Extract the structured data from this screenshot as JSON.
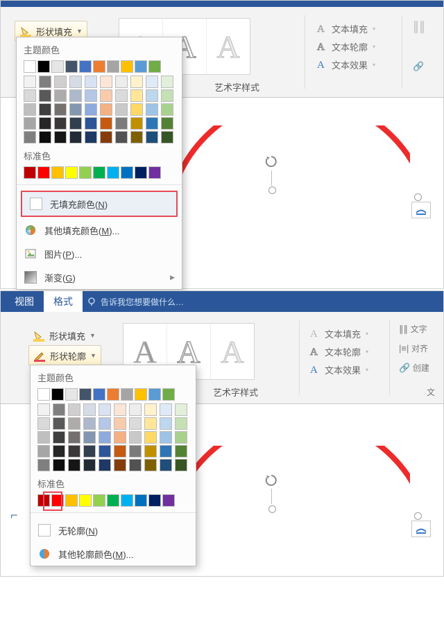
{
  "top": {
    "shape_fill_label": "形状填充",
    "wordart_label": "艺术字样式",
    "right": {
      "text_fill": "文本填充",
      "text_outline": "文本轮廓",
      "text_effects": "文本效果"
    },
    "popup": {
      "theme_colors_hdr": "主题颜色",
      "standard_colors_hdr": "标准色",
      "no_fill": "无填充颜色(",
      "no_fill_u": "N",
      "no_fill_end": ")",
      "more_colors": "其他填充颜色(",
      "more_colors_u": "M",
      "more_colors_end": ")...",
      "picture": "图片(",
      "picture_u": "P",
      "picture_end": ")...",
      "gradient": "渐变(",
      "gradient_u": "G",
      "gradient_end": ")"
    },
    "theme_row": [
      "#ffffff",
      "#000000",
      "#e7e6e6",
      "#44546a",
      "#4472c4",
      "#ed7d31",
      "#a5a5a5",
      "#ffc000",
      "#5b9bd5",
      "#70ad47"
    ],
    "theme_tints": [
      [
        "#f2f2f2",
        "#7f7f7f",
        "#d0cece",
        "#d6dce5",
        "#d9e2f3",
        "#fbe5d6",
        "#ededed",
        "#fff2cc",
        "#deebf7",
        "#e2efda"
      ],
      [
        "#d9d9d9",
        "#595959",
        "#aeabab",
        "#adb9ca",
        "#b4c7e7",
        "#f8cbad",
        "#dbdbdb",
        "#ffe699",
        "#bdd7ee",
        "#c5e0b4"
      ],
      [
        "#bfbfbf",
        "#3f3f3f",
        "#757070",
        "#8497b0",
        "#8faadc",
        "#f4b183",
        "#c9c9c9",
        "#ffd966",
        "#9dc3e6",
        "#a9d18e"
      ],
      [
        "#a6a6a6",
        "#262626",
        "#3a3838",
        "#323f4f",
        "#2e5597",
        "#c55a11",
        "#7b7b7b",
        "#bf9000",
        "#2e75b6",
        "#548235"
      ],
      [
        "#7f7f7f",
        "#0d0d0d",
        "#171616",
        "#222a35",
        "#1f3864",
        "#843c0c",
        "#525252",
        "#7f6000",
        "#1e4e79",
        "#375623"
      ]
    ],
    "standard": [
      "#c00000",
      "#ff0000",
      "#ffc000",
      "#ffff00",
      "#92d050",
      "#00b050",
      "#00b0f0",
      "#0070c0",
      "#002060",
      "#7030a0"
    ]
  },
  "bottom": {
    "tab_view": "视图",
    "tab_format": "格式",
    "tell_me": "告诉我您想要做什么…",
    "shape_fill_label": "形状填充",
    "shape_outline_label": "形状轮廓",
    "wordart_label": "艺术字样式",
    "text_col_label": "文",
    "align_label": "对齐",
    "create_label": "创建",
    "text_label": "文字",
    "right": {
      "text_fill": "文本填充",
      "text_outline": "文本轮廓",
      "text_effects": "文本效果"
    },
    "popup": {
      "theme_colors_hdr": "主题颜色",
      "standard_colors_hdr": "标准色",
      "no_outline": "无轮廓(",
      "no_outline_u": "N",
      "no_outline_end": ")",
      "more_outline": "其他轮廓颜色(",
      "more_outline_u": "M",
      "more_outline_end": ")..."
    }
  }
}
